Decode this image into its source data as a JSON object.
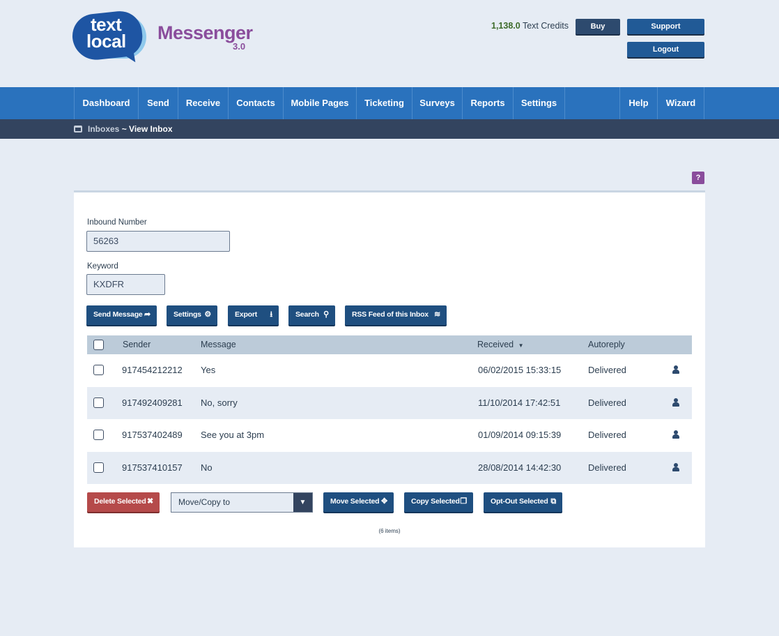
{
  "header": {
    "logo_line1": "text",
    "logo_line2": "local",
    "app_name": "Messenger",
    "app_version": "3.0",
    "credits_value": "1,138.0",
    "credits_label": "Text Credits",
    "buy_label": "Buy",
    "support_label": "Support",
    "logout_label": "Logout"
  },
  "nav": {
    "items": [
      "Dashboard",
      "Send",
      "Receive",
      "Contacts",
      "Mobile Pages",
      "Ticketing",
      "Surveys",
      "Reports",
      "Settings",
      "Help",
      "Wizard"
    ]
  },
  "breadcrumb": {
    "parent": "Inboxes",
    "separator": " ~ ",
    "current": "View Inbox"
  },
  "help_label": "?",
  "form": {
    "inbound_label": "Inbound Number",
    "inbound_value": "56263",
    "keyword_label": "Keyword",
    "keyword_value": "KXDFR"
  },
  "actions": {
    "send_message": "Send Message",
    "settings": "Settings",
    "export": "Export",
    "search": "Search",
    "rss": "RSS Feed of this Inbox"
  },
  "table": {
    "headers": {
      "sender": "Sender",
      "message": "Message",
      "received": "Received",
      "autoreply": "Autoreply"
    },
    "rows": [
      {
        "sender": "917454212212",
        "message": "Yes",
        "received": "06/02/2015 15:33:15",
        "autoreply": "Delivered"
      },
      {
        "sender": "917492409281",
        "message": "No, sorry",
        "received": "11/10/2014 17:42:51",
        "autoreply": "Delivered"
      },
      {
        "sender": "917537402489",
        "message": "See you at 3pm",
        "received": "01/09/2014 09:15:39",
        "autoreply": "Delivered"
      },
      {
        "sender": "917537410157",
        "message": "No",
        "received": "28/08/2014 14:42:30",
        "autoreply": "Delivered"
      }
    ]
  },
  "bottom": {
    "delete_selected": "Delete Selected",
    "move_copy_placeholder": "Move/Copy to",
    "move_selected": "Move Selected",
    "copy_selected": "Copy Selected",
    "optout_selected": "Opt-Out Selected",
    "item_count": "(6 items)"
  },
  "colors": {
    "nav_bg": "#2a72bd",
    "crumb_bg": "#33445f",
    "button_primary": "#1f4f80",
    "button_danger": "#b54a4a",
    "brand_purple": "#8a4d9c"
  }
}
